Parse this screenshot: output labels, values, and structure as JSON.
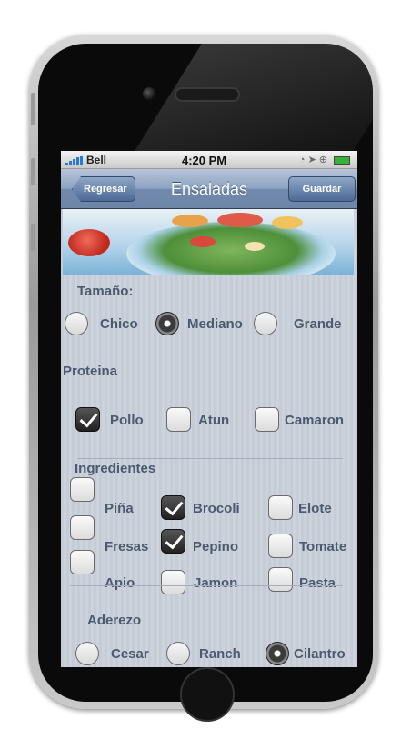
{
  "status_bar": {
    "carrier": "Bell",
    "time": "4:20 PM"
  },
  "nav": {
    "title": "Ensaladas",
    "back_label": "Regresar",
    "save_label": "Guardar"
  },
  "size": {
    "heading": "Tamaño:",
    "options": [
      {
        "label": "Chico",
        "selected": false
      },
      {
        "label": "Mediano",
        "selected": true
      },
      {
        "label": "Grande",
        "selected": false
      }
    ]
  },
  "protein": {
    "heading": "Proteina",
    "options": [
      {
        "label": "Pollo",
        "checked": true
      },
      {
        "label": "Atun",
        "checked": false
      },
      {
        "label": "Camaron",
        "checked": false
      }
    ]
  },
  "ingredients": {
    "heading": "Ingredientes",
    "items": [
      {
        "label": "Piña",
        "checked": false
      },
      {
        "label": "Brocoli",
        "checked": true
      },
      {
        "label": "Elote",
        "checked": false
      },
      {
        "label": "Fresas",
        "checked": false
      },
      {
        "label": "Pepino",
        "checked": true
      },
      {
        "label": "Tomate",
        "checked": false
      },
      {
        "label": "Apio",
        "checked": false
      },
      {
        "label": "Jamon",
        "checked": false
      },
      {
        "label": "Pasta",
        "checked": false
      }
    ]
  },
  "dressing": {
    "heading": "Aderezo",
    "options": [
      {
        "label": "Cesar",
        "selected": false
      },
      {
        "label": "Ranch",
        "selected": false
      },
      {
        "label": "Cilantro",
        "selected": true
      }
    ]
  },
  "colors": {
    "nav_bar": "#7089ad",
    "label_text": "#4b5a70",
    "screen_bg": "#c9cfd8"
  }
}
